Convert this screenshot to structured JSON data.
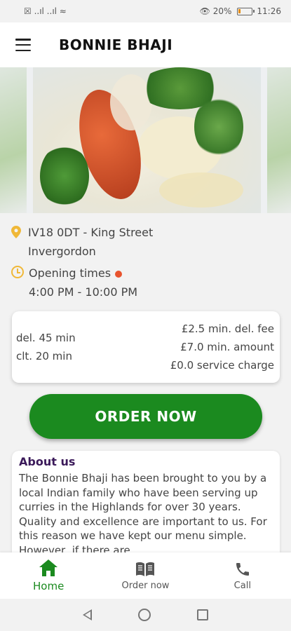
{
  "status_bar": {
    "left": "☒ ..ıl ..ıl ≈",
    "battery_text": "👁 20%",
    "time": "11:26"
  },
  "header": {
    "title": "BONNIE BHAJI"
  },
  "info": {
    "address_line1": "IV18 0DT - King Street",
    "address_line2": "Invergordon",
    "opening_label": "Opening times",
    "opening_hours": "4:00 PM - 10:00 PM"
  },
  "delivery": {
    "del_time": "del. 45 min",
    "clt_time": "clt. 20 min",
    "min_fee": "£2.5 min. del. fee",
    "min_amount": "£7.0 min. amount",
    "service_charge": "£0.0 service charge"
  },
  "order_button": {
    "label": "ORDER NOW"
  },
  "about": {
    "title": "About us",
    "text": "The Bonnie Bhaji has been brought to you by a local Indian family who have been serving up curries in the Highlands for over 30 years. Quality and excellence are important to us. For this reason we have kept our menu simple. However, if there are"
  },
  "bottom_nav": {
    "items": [
      {
        "label": "Home",
        "icon": "home-icon",
        "active": true
      },
      {
        "label": "Order now",
        "icon": "menu-book-icon",
        "active": false
      },
      {
        "label": "Call",
        "icon": "phone-icon",
        "active": false
      }
    ]
  },
  "colors": {
    "brand_green": "#1b8a1f",
    "accent_yellow": "#f0b838",
    "status_open_dot": "#e8542e",
    "about_title": "#3b1a5a"
  }
}
